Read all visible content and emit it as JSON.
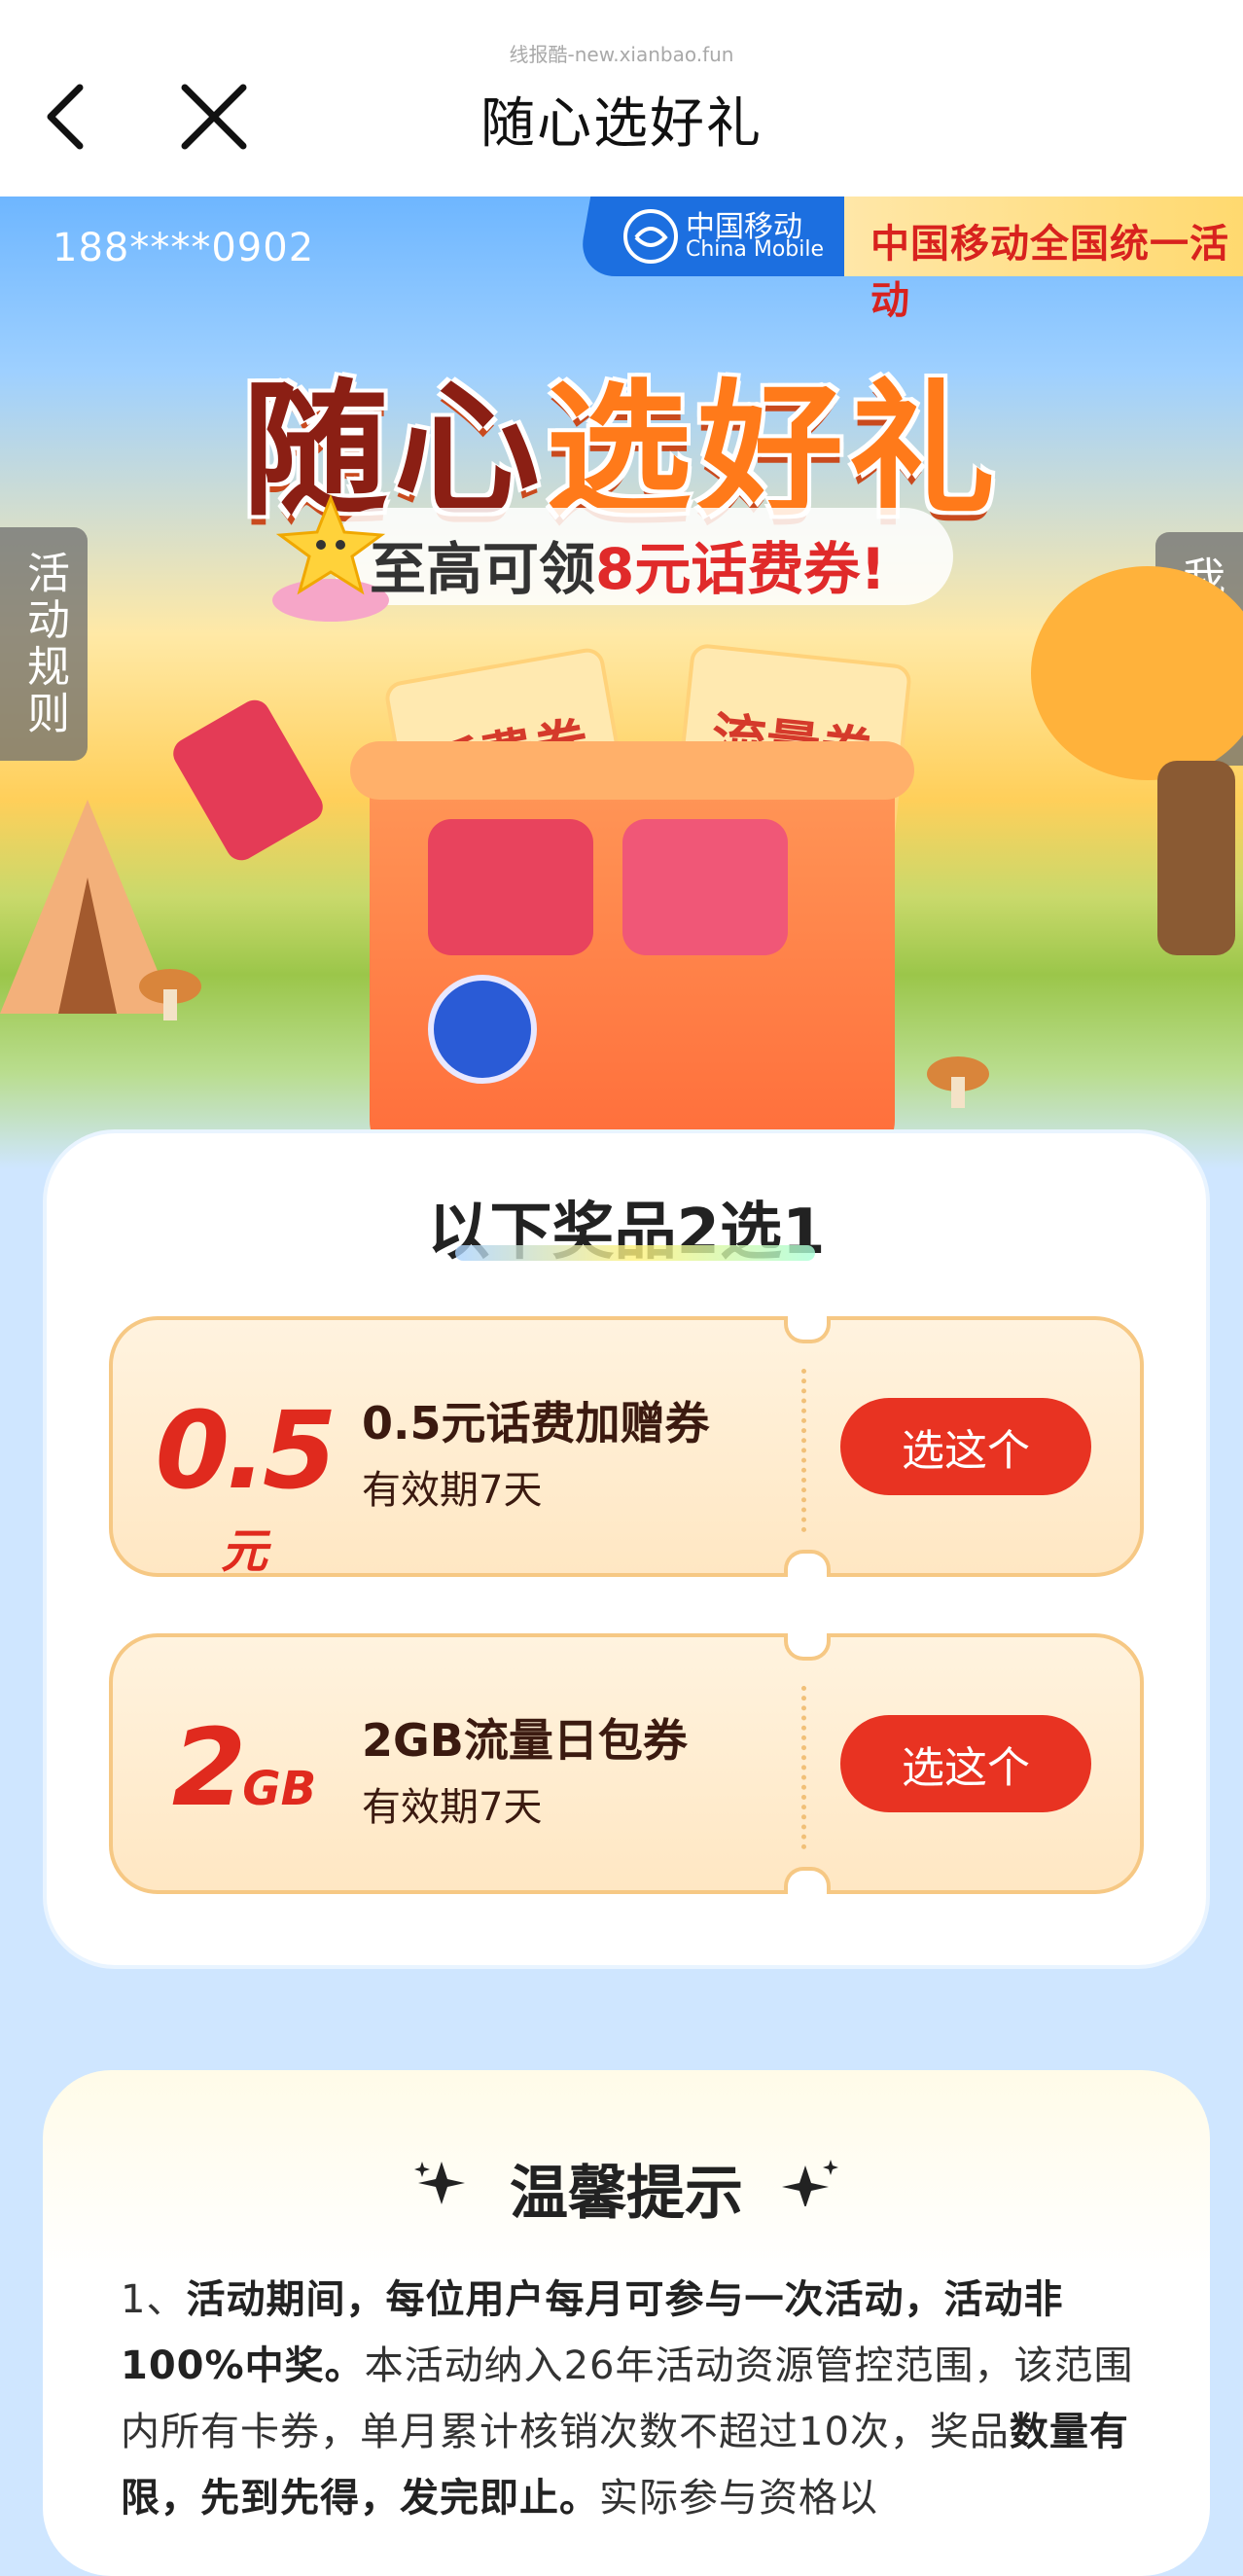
{
  "navbar": {
    "watermark": "线报酷-new.xianbao.fun",
    "title": "随心选好礼"
  },
  "hero": {
    "phone": "188****0902",
    "brand_cn": "中国移动",
    "brand_en": "China Mobile",
    "campaign": "中国移动全国统一活动",
    "title_part1": "随心",
    "title_part2": "选好礼",
    "subtitle_prefix": "至高可领",
    "subtitle_highlight": "8元话费券!",
    "rules_tab": "活动规则",
    "my_prizes_tab": "我的奖品",
    "ticket_left": "话费券",
    "ticket_right": "流量券"
  },
  "prize": {
    "heading": "以下奖品2选1",
    "items": [
      {
        "amount": "0.5",
        "unit": "元",
        "name": "0.5元话费加赠券",
        "validity": "有效期7天",
        "button": "选这个"
      },
      {
        "amount": "2",
        "unit": "GB",
        "name": "2GB流量日包券",
        "validity": "有效期7天",
        "button": "选这个"
      }
    ]
  },
  "tips": {
    "heading": "温馨提示",
    "line1_prefix": "1、",
    "line1_bold": "活动期间，每位用户每月可参与一次活动，活动非100%中奖。",
    "line1_rest": "本活动纳入26年活动资源管控范围，该范围内所有卡券，单月累计核销次数不超过10次，奖品",
    "line1_bold2": "数量有限，先到先得，发完即止。",
    "line1_tail": "实际参与资格以"
  },
  "colors": {
    "accent_red": "#e83322",
    "brand_blue": "#1c6fe0",
    "coupon_border": "#f6c884"
  }
}
